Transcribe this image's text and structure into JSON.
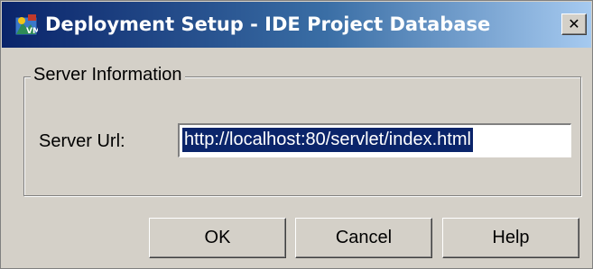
{
  "window": {
    "title": "Deployment Setup - IDE Project Database",
    "close_glyph": "✕",
    "icon": "app-icon"
  },
  "server_info": {
    "group_label": "Server Information",
    "url_label": "Server Url:",
    "url_value": "http://localhost:80/servlet/index.html"
  },
  "buttons": {
    "ok": "OK",
    "cancel": "Cancel",
    "help": "Help"
  },
  "colors": {
    "titlebar_start": "#0a246a",
    "titlebar_end": "#a6caf0",
    "dialog_face": "#d4d0c8",
    "selection": "#0a246a"
  }
}
